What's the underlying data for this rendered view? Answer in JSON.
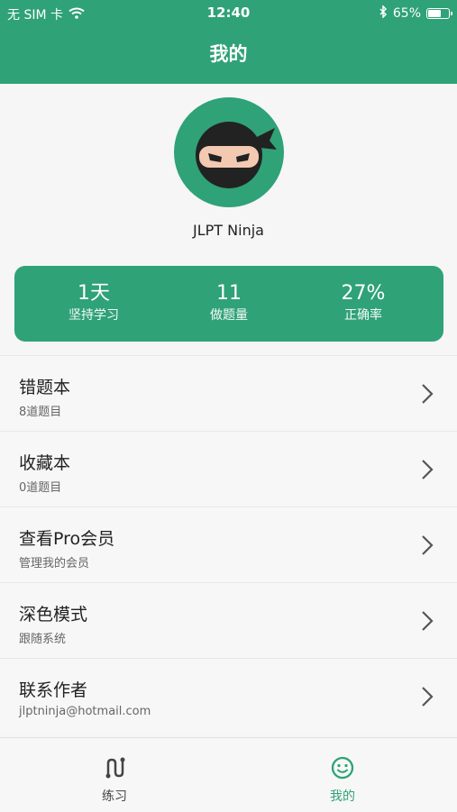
{
  "status_bar": {
    "carrier": "无 SIM 卡",
    "time": "12:40",
    "battery": "65%",
    "battery_level": 0.65
  },
  "header": {
    "title": "我的"
  },
  "profile": {
    "username": "JLPT Ninja"
  },
  "stats": [
    {
      "value": "1天",
      "label": "坚持学习"
    },
    {
      "value": "11",
      "label": "做题量"
    },
    {
      "value": "27%",
      "label": "正确率"
    }
  ],
  "menu": [
    {
      "title": "错题本",
      "subtitle": "8道题目"
    },
    {
      "title": "收藏本",
      "subtitle": "0道题目"
    },
    {
      "title": "查看Pro会员",
      "subtitle": "管理我的会员"
    },
    {
      "title": "深色模式",
      "subtitle": "跟随系统"
    },
    {
      "title": "联系作者",
      "subtitle": "jlptninja@hotmail.com"
    }
  ],
  "tabbar": {
    "tabs": [
      {
        "label": "练习",
        "icon": "practice-icon"
      },
      {
        "label": "我的",
        "icon": "smiley-icon"
      }
    ],
    "active_color": "#2fa277"
  },
  "colors": {
    "brand": "#2fa277"
  }
}
